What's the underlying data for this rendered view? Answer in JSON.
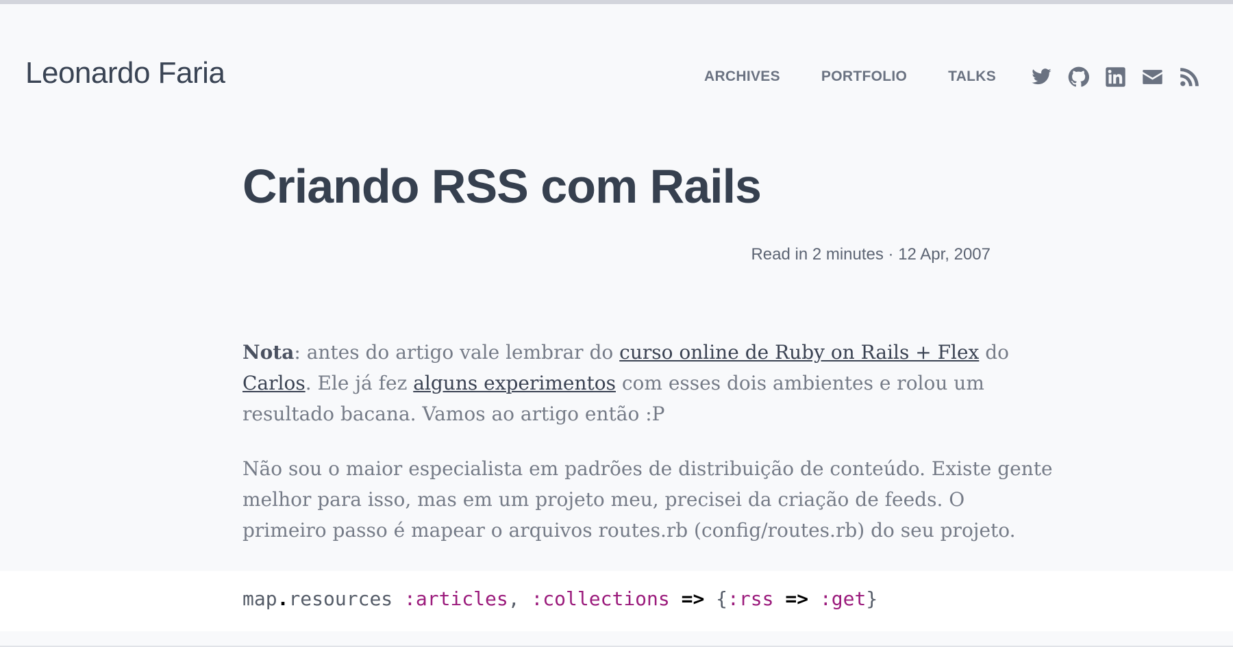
{
  "header": {
    "site_title": "Leonardo Faria",
    "nav": [
      {
        "label": "ARCHIVES"
      },
      {
        "label": "PORTFOLIO"
      },
      {
        "label": "TALKS"
      }
    ],
    "social": [
      "twitter-icon",
      "github-icon",
      "linkedin-icon",
      "email-icon",
      "rss-icon"
    ]
  },
  "post": {
    "title": "Criando RSS com Rails",
    "meta": "Read in 2 minutes · 12 Apr, 2007",
    "p1": {
      "nota": "Nota",
      "t1": ": antes do artigo vale lembrar do ",
      "link1": "curso online de Ruby on Rails + Flex",
      "t2": " do",
      "link2": "Carlos",
      "t3": ". Ele já fez ",
      "link3": "alguns experimentos",
      "t4": " com esses dois ambientes e rolou um",
      "t5": "resultado bacana. Vamos ao artigo então :P"
    },
    "p2": [
      "Não sou o maior especialista em padrões de distribuição de conteúdo. Existe gente",
      "melhor para isso, mas em um projeto meu, precisei da criação de feeds. O",
      "primeiro passo é mapear o arquivos routes.rb (config/routes.rb) do seu projeto."
    ]
  },
  "code": {
    "t1": "map",
    "t2": ".",
    "t3": "resources ",
    "t4": ":articles",
    "t5": ", ",
    "t6": ":collections",
    "t7": " ",
    "t8": "=>",
    "t9": " {",
    "t10": ":rss",
    "t11": " ",
    "t12": "=>",
    "t13": " ",
    "t14": ":get",
    "t15": "}"
  },
  "colors": {
    "background": "#f8f9fb",
    "title": "#36404f",
    "muted": "#6a7281",
    "symbol": "#9b1b7c"
  }
}
